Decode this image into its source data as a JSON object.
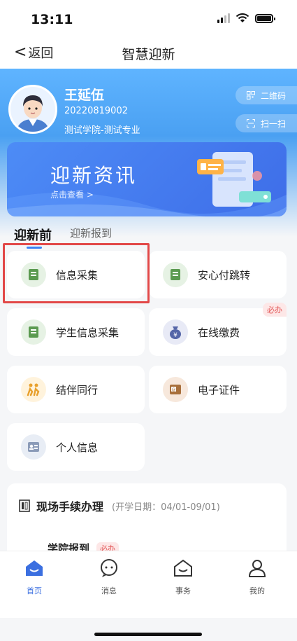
{
  "status": {
    "time": "13:11"
  },
  "nav": {
    "back_label": "返回",
    "title": "智慧迎新"
  },
  "user": {
    "name": "王延伍",
    "id": "20220819002",
    "dept": "测试学院-测试专业"
  },
  "actions": {
    "qr_label": "二维码",
    "scan_label": "扫一扫"
  },
  "banner": {
    "title": "迎新资讯",
    "subtitle": "点击查看 >"
  },
  "tabs": [
    {
      "label": "迎新前"
    },
    {
      "label": "迎新报到"
    }
  ],
  "services": [
    {
      "label": "信息采集",
      "icon": "document-icon"
    },
    {
      "label": "安心付跳转",
      "icon": "document-icon"
    },
    {
      "label": "学生信息采集",
      "icon": "document-icon"
    },
    {
      "label": "在线缴费",
      "icon": "money-bag-icon",
      "badge": "必办"
    },
    {
      "label": "结伴同行",
      "icon": "people-icon"
    },
    {
      "label": "电子证件",
      "icon": "id-card-icon"
    },
    {
      "label": "个人信息",
      "icon": "profile-card-icon"
    }
  ],
  "section": {
    "title": "现场手续办理",
    "date": "(开学日期：04/01-09/01)",
    "item_label": "学院报到",
    "item_badge": "必办"
  },
  "tabbar": [
    {
      "label": "首页",
      "icon": "home-icon"
    },
    {
      "label": "消息",
      "icon": "message-icon"
    },
    {
      "label": "事务",
      "icon": "inbox-icon"
    },
    {
      "label": "我的",
      "icon": "user-icon"
    }
  ],
  "colors": {
    "accent": "#3b6fe0",
    "highlight": "#e24848",
    "badge_bg": "#fde7e7",
    "badge_text": "#e25555"
  }
}
